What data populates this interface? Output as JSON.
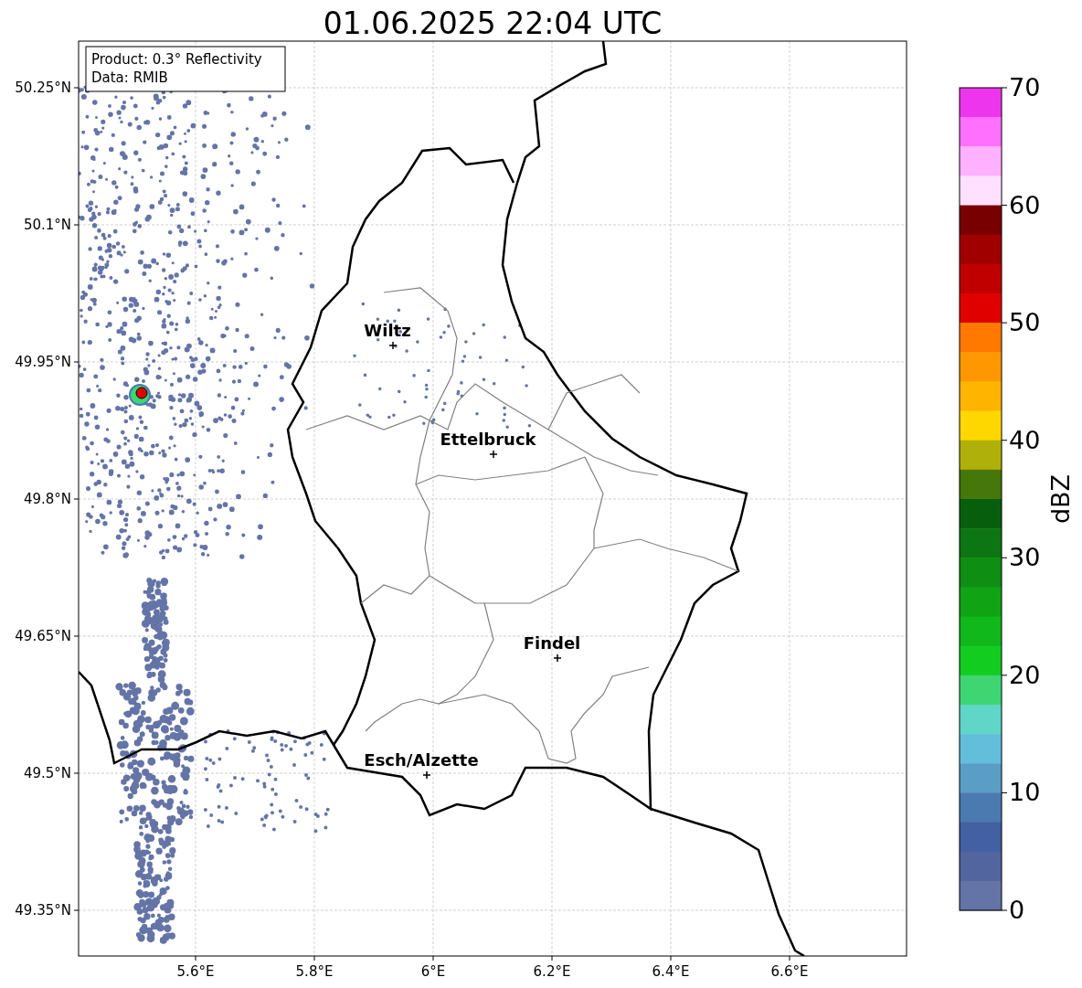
{
  "title": "01.06.2025 22:04 UTC",
  "annotation": [
    "Product: 0.3° Reflectivity",
    "Data: RMIB"
  ],
  "x_ticks": [
    "5.6°E",
    "5.8°E",
    "6°E",
    "6.2°E",
    "6.4°E",
    "6.6°E"
  ],
  "y_ticks": [
    "50.25°N",
    "50.1°N",
    "49.95°N",
    "49.8°N",
    "49.65°N",
    "49.5°N",
    "49.35°N"
  ],
  "cities": [
    {
      "name": "Wiltz"
    },
    {
      "name": "Ettelbruck"
    },
    {
      "name": "Findel"
    },
    {
      "name": "Esch/Alzette"
    }
  ],
  "colorbar": {
    "label": "dBZ",
    "ticks": [
      "70",
      "60",
      "50",
      "40",
      "30",
      "20",
      "10",
      "0"
    ],
    "segments": [
      {
        "color": "#ee35ee"
      },
      {
        "color": "#ff70ff"
      },
      {
        "color": "#ffb0ff"
      },
      {
        "color": "#ffe0ff"
      },
      {
        "color": "#780000"
      },
      {
        "color": "#a00000"
      },
      {
        "color": "#c00000"
      },
      {
        "color": "#e00000"
      },
      {
        "color": "#ff7800"
      },
      {
        "color": "#ff9800"
      },
      {
        "color": "#ffb400"
      },
      {
        "color": "#ffd700"
      },
      {
        "color": "#b0b00a"
      },
      {
        "color": "#46770a"
      },
      {
        "color": "#075f0e"
      },
      {
        "color": "#0c7612"
      },
      {
        "color": "#0e8e12"
      },
      {
        "color": "#10a414"
      },
      {
        "color": "#10b81c"
      },
      {
        "color": "#13cc20"
      },
      {
        "color": "#3ed672"
      },
      {
        "color": "#60d6c6"
      },
      {
        "color": "#62bedb"
      },
      {
        "color": "#5a9ec6"
      },
      {
        "color": "#4b7ab0"
      },
      {
        "color": "#4260a2"
      },
      {
        "color": "#52659e"
      },
      {
        "color": "#6474a6"
      }
    ]
  }
}
